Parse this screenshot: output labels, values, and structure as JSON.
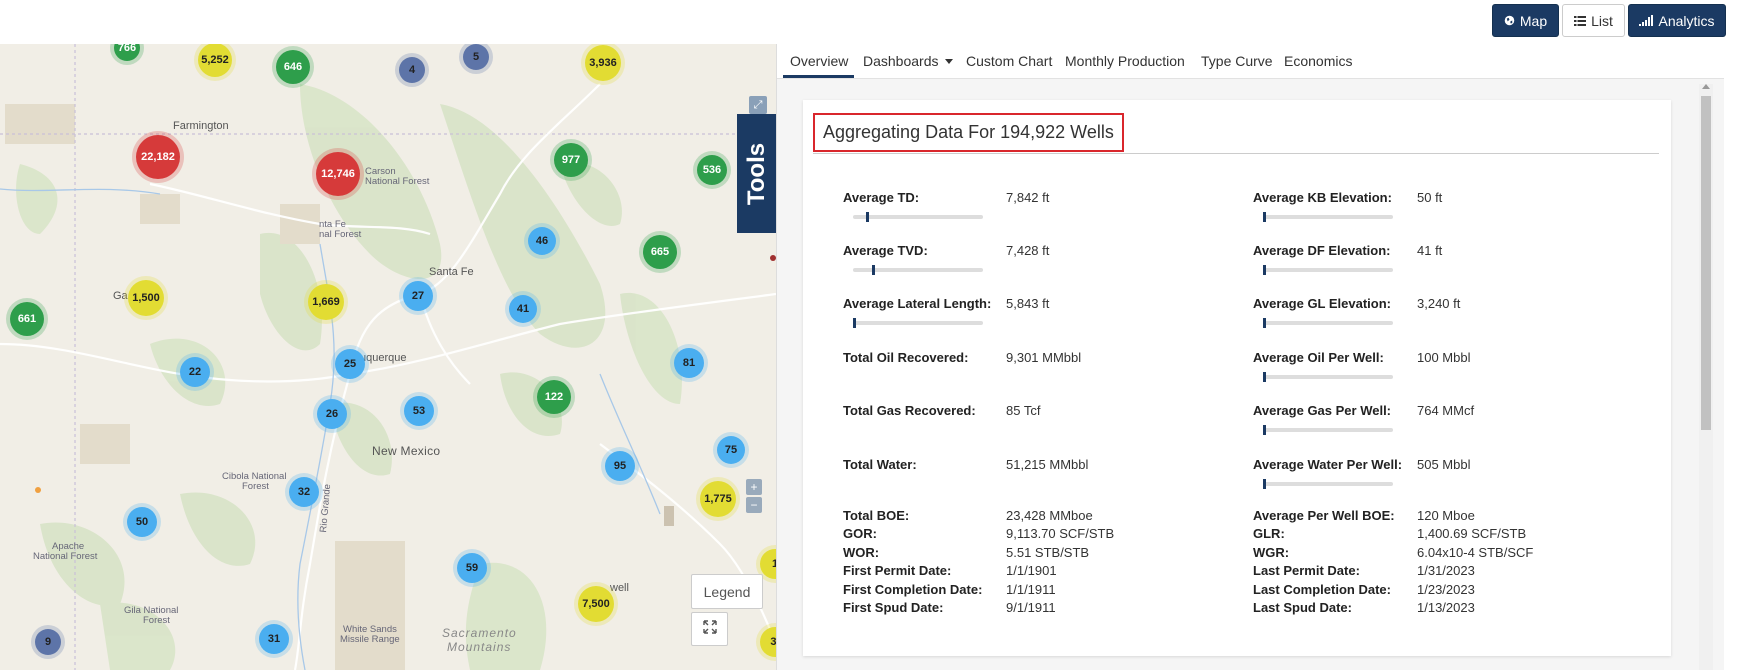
{
  "topbar": {
    "map_label": "Map",
    "list_label": "List",
    "analytics_label": "Analytics"
  },
  "map": {
    "tools_label": "Tools",
    "legend_label": "Legend",
    "places": {
      "farmington": "Farmington",
      "carson": "Carson",
      "national_forest": "National Forest",
      "nta_fe": "nta Fe",
      "nal_forest": "nal Forest",
      "santa_fe": "Santa Fe",
      "uquerque": "uquerque",
      "new_mexico": "New Mexico",
      "cibola_1": "Cibola National",
      "cibola_2": "Forest",
      "apache_1": "Apache",
      "apache_2": "National Forest",
      "gila_1": "Gila National",
      "gila_2": "Forest",
      "white_sands_1": "White Sands",
      "white_sands_2": "Missile Range",
      "sacramento_1": "Sacramento",
      "sacramento_2": "Mountains",
      "rio_grande": "Rio Grande",
      "well": "well",
      "ga": "Ga"
    },
    "clusters": [
      {
        "label": "766",
        "color": "green"
      },
      {
        "label": "5,252",
        "color": "yellow"
      },
      {
        "label": "646",
        "color": "green"
      },
      {
        "label": "4",
        "color": "navy"
      },
      {
        "label": "5",
        "color": "navy"
      },
      {
        "label": "3,936",
        "color": "yellow"
      },
      {
        "label": "22,182",
        "color": "red"
      },
      {
        "label": "12,746",
        "color": "red"
      },
      {
        "label": "977",
        "color": "green"
      },
      {
        "label": "536",
        "color": "green"
      },
      {
        "label": "46",
        "color": "blue"
      },
      {
        "label": "665",
        "color": "green"
      },
      {
        "label": "661",
        "color": "green"
      },
      {
        "label": "1,500",
        "color": "yellow"
      },
      {
        "label": "1,669",
        "color": "yellow"
      },
      {
        "label": "27",
        "color": "blue"
      },
      {
        "label": "41",
        "color": "blue"
      },
      {
        "label": "22",
        "color": "blue"
      },
      {
        "label": "25",
        "color": "blue"
      },
      {
        "label": "81",
        "color": "blue"
      },
      {
        "label": "122",
        "color": "green"
      },
      {
        "label": "26",
        "color": "blue"
      },
      {
        "label": "53",
        "color": "blue"
      },
      {
        "label": "75",
        "color": "blue"
      },
      {
        "label": "95",
        "color": "blue"
      },
      {
        "label": "1,775",
        "color": "yellow"
      },
      {
        "label": "32",
        "color": "blue"
      },
      {
        "label": "50",
        "color": "blue"
      },
      {
        "label": "59",
        "color": "blue"
      },
      {
        "label": "7,500",
        "color": "yellow"
      },
      {
        "label": "9",
        "color": "navy"
      },
      {
        "label": "31",
        "color": "blue"
      },
      {
        "label": "1",
        "color": "yellow"
      },
      {
        "label": "3,",
        "color": "yellow"
      }
    ]
  },
  "tabs": [
    {
      "label": "Overview"
    },
    {
      "label": "Dashboards"
    },
    {
      "label": "Custom Chart"
    },
    {
      "label": "Monthly Production"
    },
    {
      "label": "Type Curve"
    },
    {
      "label": "Economics"
    }
  ],
  "overview": {
    "title": "Aggregating Data For 194,922 Wells",
    "left_metrics": [
      {
        "label": "Average TD:",
        "value": "7,842 ft",
        "level": 0.1
      },
      {
        "label": "Average TVD:",
        "value": "7,428 ft",
        "level": 0.15
      },
      {
        "label": "Average Lateral Length:",
        "value": "5,843 ft",
        "level": 0.0
      },
      {
        "label": "Total Oil Recovered:",
        "value": "9,301 MMbbl"
      },
      {
        "label": "Total Gas Recovered:",
        "value": "85 Tcf"
      },
      {
        "label": "Total Water:",
        "value": "51,215 MMbbl"
      }
    ],
    "right_metrics": [
      {
        "label": "Average KB Elevation:",
        "value": "50 ft",
        "level": 0.0
      },
      {
        "label": "Average DF Elevation:",
        "value": "41 ft",
        "level": 0.0
      },
      {
        "label": "Average GL Elevation:",
        "value": "3,240 ft",
        "level": 0.0
      },
      {
        "label": "Average Oil Per Well:",
        "value": "100 Mbbl",
        "level": 0.0
      },
      {
        "label": "Average Gas Per Well:",
        "value": "764 MMcf",
        "level": 0.0
      },
      {
        "label": "Average Water Per Well:",
        "value": "505 Mbbl",
        "level": 0.0
      }
    ],
    "left_footer": [
      {
        "label": "Total BOE:",
        "value": "23,428 MMboe"
      },
      {
        "label": "GOR:",
        "value": "9,113.70 SCF/STB"
      },
      {
        "label": "WOR:",
        "value": "5.51 STB/STB"
      },
      {
        "label": "First Permit Date:",
        "value": "1/1/1901"
      },
      {
        "label": "First Completion Date:",
        "value": "1/1/1911"
      },
      {
        "label": "First Spud Date:",
        "value": "9/1/1911"
      }
    ],
    "right_footer": [
      {
        "label": "Average Per Well BOE:",
        "value": "120 Mboe"
      },
      {
        "label": "GLR:",
        "value": "1,400.69 SCF/STB"
      },
      {
        "label": "WGR:",
        "value": "6.04x10-4 STB/SCF"
      },
      {
        "label": "Last Permit Date:",
        "value": "1/31/2023"
      },
      {
        "label": "Last Completion Date:",
        "value": "1/23/2023"
      },
      {
        "label": "Last Spud Date:",
        "value": "1/13/2023"
      }
    ]
  }
}
